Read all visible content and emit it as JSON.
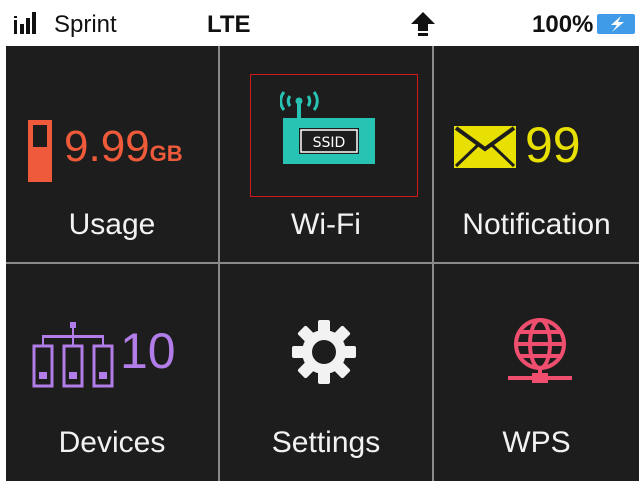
{
  "status_bar": {
    "carrier": "Sprint",
    "network": "LTE",
    "battery": "100%",
    "icons": [
      "signal-icon",
      "upload-arrow-icon",
      "battery-charging-icon"
    ]
  },
  "tiles": {
    "usage": {
      "label": "Usage",
      "value": "9.99",
      "unit": "GB",
      "icon": "battery-icon"
    },
    "wifi": {
      "label": "Wi-Fi",
      "badge": "SSID",
      "icon": "wifi-ssid-icon",
      "selected": true
    },
    "notification": {
      "label": "Notification",
      "count": "99",
      "icon": "envelope-icon"
    },
    "devices": {
      "label": "Devices",
      "count": "10",
      "icon": "devices-network-icon"
    },
    "settings": {
      "label": "Settings",
      "icon": "gear-icon"
    },
    "wps": {
      "label": "WPS",
      "icon": "globe-icon"
    }
  },
  "colors": {
    "background": "#1d1d1d",
    "grid_lines": "#8a8a8a",
    "usage": "#ef5a3a",
    "wifi": "#27c4b4",
    "notification": "#e8e000",
    "devices": "#b27de8",
    "wps": "#f04e6e",
    "selection_border": "#d01818"
  }
}
